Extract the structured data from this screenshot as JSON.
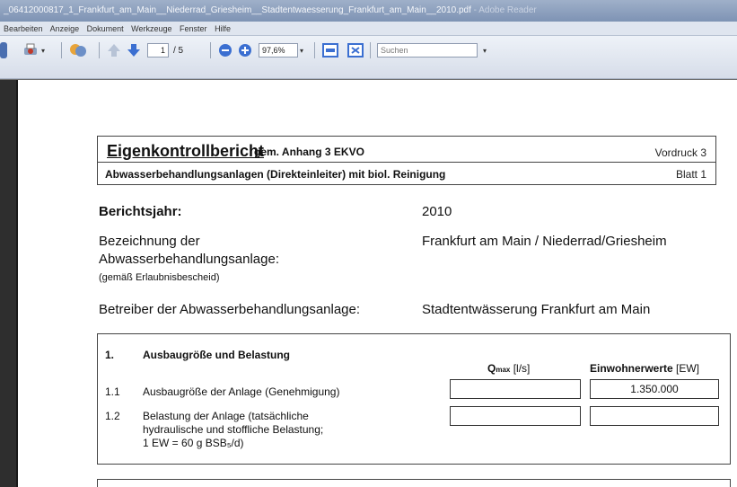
{
  "window": {
    "title": "_06412000817_1_Frankfurt_am_Main__Niederrad_Griesheim__Stadtentwaesserung_Frankfurt_am_Main__2010.pdf",
    "app_suffix": " - Adobe Reader"
  },
  "menu": [
    "Bearbeiten",
    "Anzeige",
    "Dokument",
    "Werkzeuge",
    "Fenster",
    "Hilfe"
  ],
  "toolbar": {
    "page_current": "1",
    "page_total": "/ 5",
    "zoom": "97,6%",
    "search_placeholder": "Suchen"
  },
  "document": {
    "header": {
      "title": "Eigenkontrollbericht",
      "title_suffix": "gem. Anhang 3 EKVO",
      "vordruck": "Vordruck 3",
      "subtitle": "Abwasserbehandlungsanlagen (Direkteinleiter) mit biol. Reinigung",
      "blatt": "Blatt 1"
    },
    "berichtsjahr_label": "Berichtsjahr:",
    "berichtsjahr_value": "2010",
    "bezeichnung_label_1": "Bezeichnung der",
    "bezeichnung_label_2": "Abwasserbehandlungsanlage:",
    "bezeichnung_note": "(gemäß Erlaubnisbescheid)",
    "bezeichnung_value": "Frankfurt am Main / Niederrad/Griesheim",
    "betreiber_label": "Betreiber der Abwasserbehandlungsanlage:",
    "betreiber_value": "Stadtentwässerung Frankfurt am Main",
    "section1": {
      "number": "1.",
      "title": "Ausbaugröße und Belastung",
      "col_q_label": "Q",
      "col_q_sub": "max",
      "col_q_unit": " [l/s]",
      "col_ew_label": "Einwohnerwerte",
      "col_ew_unit": " [EW]",
      "rows": [
        {
          "num": "1.1",
          "label": "Ausbaugröße der Anlage (Genehmigung)",
          "q": "",
          "ew": "1.350.000"
        },
        {
          "num": "1.2",
          "label_1": "Belastung der Anlage (tatsächliche",
          "label_2": "hydraulische und stoffliche Belastung;",
          "label_3": "1 EW = 60 g BSB₅/d)",
          "q": "",
          "ew": ""
        }
      ]
    }
  }
}
